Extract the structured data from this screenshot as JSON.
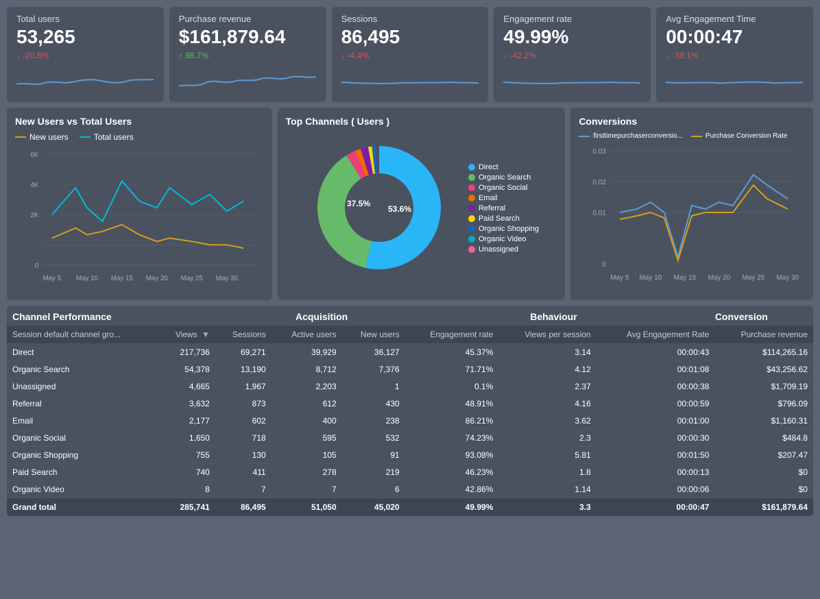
{
  "kpis": [
    {
      "label": "Total users",
      "value": "53,265",
      "change": "↓ -20.8%",
      "change_type": "down",
      "sparkline_color": "#5b9bd5"
    },
    {
      "label": "Purchase revenue",
      "value": "$161,879.64",
      "change": "↑ 98.7%",
      "change_type": "up",
      "sparkline_color": "#5b9bd5"
    },
    {
      "label": "Sessions",
      "value": "86,495",
      "change": "↓ -4.4%",
      "change_type": "down",
      "sparkline_color": "#5b9bd5"
    },
    {
      "label": "Engagement rate",
      "value": "49.99%",
      "change": "↓ -42.2%",
      "change_type": "down",
      "sparkline_color": "#5b9bd5"
    },
    {
      "label": "Avg Engagement Time",
      "value": "00:00:47",
      "change": "↓ -39.1%",
      "change_type": "down",
      "sparkline_color": "#5b9bd5"
    }
  ],
  "new_vs_total": {
    "title": "New Users vs Total Users",
    "legend": [
      {
        "label": "New users",
        "color": "#d4a017"
      },
      {
        "label": "Total users",
        "color": "#00bcd4"
      }
    ],
    "x_labels": [
      "May 5",
      "May 10",
      "May 15",
      "May 20",
      "May 25",
      "May 30"
    ],
    "y_labels": [
      "0",
      "2K",
      "4K",
      "6K"
    ]
  },
  "top_channels": {
    "title": "Top Channels ( Users )",
    "legend": [
      {
        "label": "Direct",
        "color": "#29b6f6"
      },
      {
        "label": "Organic Search",
        "color": "#66bb6a"
      },
      {
        "label": "Organic Social",
        "color": "#ec407a"
      },
      {
        "label": "Email",
        "color": "#ef6c00"
      },
      {
        "label": "Referral",
        "color": "#7b1fa2"
      },
      {
        "label": "Paid Search",
        "color": "#ffd600"
      },
      {
        "label": "Organic Shopping",
        "color": "#1565c0"
      },
      {
        "label": "Organic Video",
        "color": "#00acc1"
      },
      {
        "label": "Unassigned",
        "color": "#f06292"
      }
    ],
    "slices": [
      {
        "label": "Direct",
        "value": 53.6,
        "color": "#29b6f6"
      },
      {
        "label": "Organic Search",
        "value": 37.5,
        "color": "#66bb6a"
      },
      {
        "label": "Organic Social",
        "value": 2.5,
        "color": "#ec407a"
      },
      {
        "label": "Email",
        "value": 1.5,
        "color": "#ef6c00"
      },
      {
        "label": "Referral",
        "value": 2.0,
        "color": "#7b1fa2"
      },
      {
        "label": "Paid Search",
        "value": 1.0,
        "color": "#ffd600"
      },
      {
        "label": "Organic Shopping",
        "value": 1.0,
        "color": "#1565c0"
      },
      {
        "label": "Organic Video",
        "value": 0.5,
        "color": "#00acc1"
      },
      {
        "label": "Unassigned",
        "value": 0.4,
        "color": "#f06292"
      }
    ],
    "inner_labels": [
      "37.5%",
      "53.6%"
    ]
  },
  "conversions": {
    "title": "Conversions",
    "legend": [
      {
        "label": "firsttimepurchaserconversio...",
        "color": "#5b9bd5"
      },
      {
        "label": "Purchase Conversion Rate",
        "color": "#d4a017"
      }
    ],
    "x_labels": [
      "May 5",
      "May 10",
      "May 15",
      "May 20",
      "May 25",
      "May 30"
    ],
    "y_labels": [
      "0",
      "0.01",
      "0.02",
      "0.03"
    ]
  },
  "table": {
    "section_labels": {
      "channel": "Channel Performance",
      "acquisition": "Acquisition",
      "behaviour": "Behaviour",
      "conversion": "Conversion"
    },
    "columns": [
      "Session default channel gro...",
      "Views ▼",
      "Sessions",
      "Active users",
      "New users",
      "Engagement rate",
      "Views per session",
      "Avg Engagement Rate",
      "Purchase revenue"
    ],
    "rows": [
      [
        "Direct",
        "217,736",
        "69,271",
        "39,929",
        "36,127",
        "45.37%",
        "3.14",
        "00:00:43",
        "$114,265.16"
      ],
      [
        "Organic Search",
        "54,378",
        "13,190",
        "8,712",
        "7,376",
        "71.71%",
        "4.12",
        "00:01:08",
        "$43,256.62"
      ],
      [
        "Unassigned",
        "4,665",
        "1,967",
        "2,203",
        "1",
        "0.1%",
        "2.37",
        "00:00:38",
        "$1,709.19"
      ],
      [
        "Referral",
        "3,632",
        "873",
        "612",
        "430",
        "48.91%",
        "4.16",
        "00:00:59",
        "$796.09"
      ],
      [
        "Email",
        "2,177",
        "602",
        "400",
        "238",
        "86.21%",
        "3.62",
        "00:01:00",
        "$1,160.31"
      ],
      [
        "Organic Social",
        "1,650",
        "718",
        "595",
        "532",
        "74.23%",
        "2.3",
        "00:00:30",
        "$484.8"
      ],
      [
        "Organic Shopping",
        "755",
        "130",
        "105",
        "91",
        "93.08%",
        "5.81",
        "00:01:50",
        "$207.47"
      ],
      [
        "Paid Search",
        "740",
        "411",
        "278",
        "219",
        "46.23%",
        "1.8",
        "00:00:13",
        "$0"
      ],
      [
        "Organic Video",
        "8",
        "7",
        "7",
        "6",
        "42.86%",
        "1.14",
        "00:00:06",
        "$0"
      ]
    ],
    "footer": [
      "Grand total",
      "285,741",
      "86,495",
      "51,050",
      "45,020",
      "49.99%",
      "3.3",
      "00:00:47",
      "$161,879.64"
    ]
  }
}
